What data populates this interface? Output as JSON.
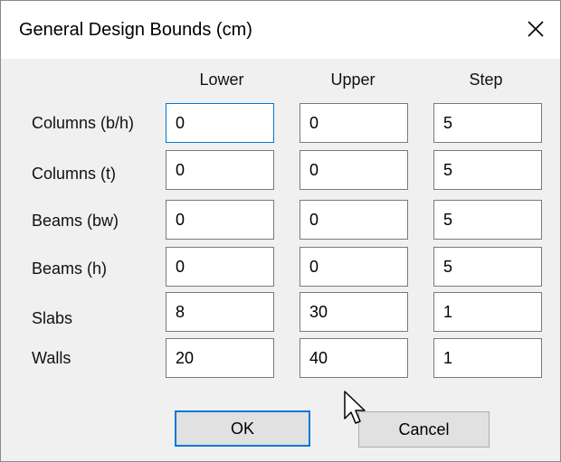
{
  "window": {
    "title": "General Design Bounds (cm)",
    "close_icon": "close-icon"
  },
  "columns": {
    "lower": "Lower",
    "upper": "Upper",
    "step": "Step"
  },
  "rows": [
    {
      "label": "Columns (b/h)",
      "lower": "0",
      "upper": "0",
      "step": "5"
    },
    {
      "label": "Columns (t)",
      "lower": "0",
      "upper": "0",
      "step": "5"
    },
    {
      "label": "Beams (bw)",
      "lower": "0",
      "upper": "0",
      "step": "5"
    },
    {
      "label": "Beams (h)",
      "lower": "0",
      "upper": "0",
      "step": "5"
    },
    {
      "label": "Slabs",
      "lower": "8",
      "upper": "30",
      "step": "1"
    },
    {
      "label": "Walls",
      "lower": "20",
      "upper": "40",
      "step": "1"
    }
  ],
  "buttons": {
    "ok": "OK",
    "cancel": "Cancel"
  },
  "colors": {
    "focus_accent": "#0078d7",
    "dialog_background": "#f0f0f0"
  }
}
